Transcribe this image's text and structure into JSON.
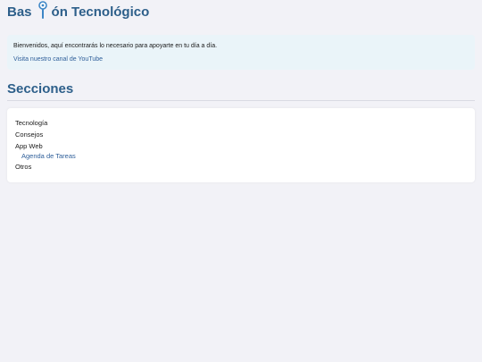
{
  "header": {
    "title_left": "Bas",
    "title_right": "ón Tecnológico",
    "icon": "pin-icon"
  },
  "welcome": {
    "text": "Bienvenidos, aquí encontrarás lo necesario para apoyarte en tu día a día.",
    "youtube_link": "Visita nuestro canal de YouTube"
  },
  "sections": {
    "heading": "Secciones",
    "items": [
      {
        "label": "Tecnología"
      },
      {
        "label": "Consejos"
      },
      {
        "label": "App Web",
        "children": [
          {
            "label": "Agenda de Tareas"
          }
        ]
      },
      {
        "label": "Otros"
      }
    ]
  },
  "colors": {
    "accent": "#2d5f8a",
    "link": "#2f5f9a",
    "page_bg": "#f2f2f7",
    "welcome_bg": "#eaf4f9"
  }
}
